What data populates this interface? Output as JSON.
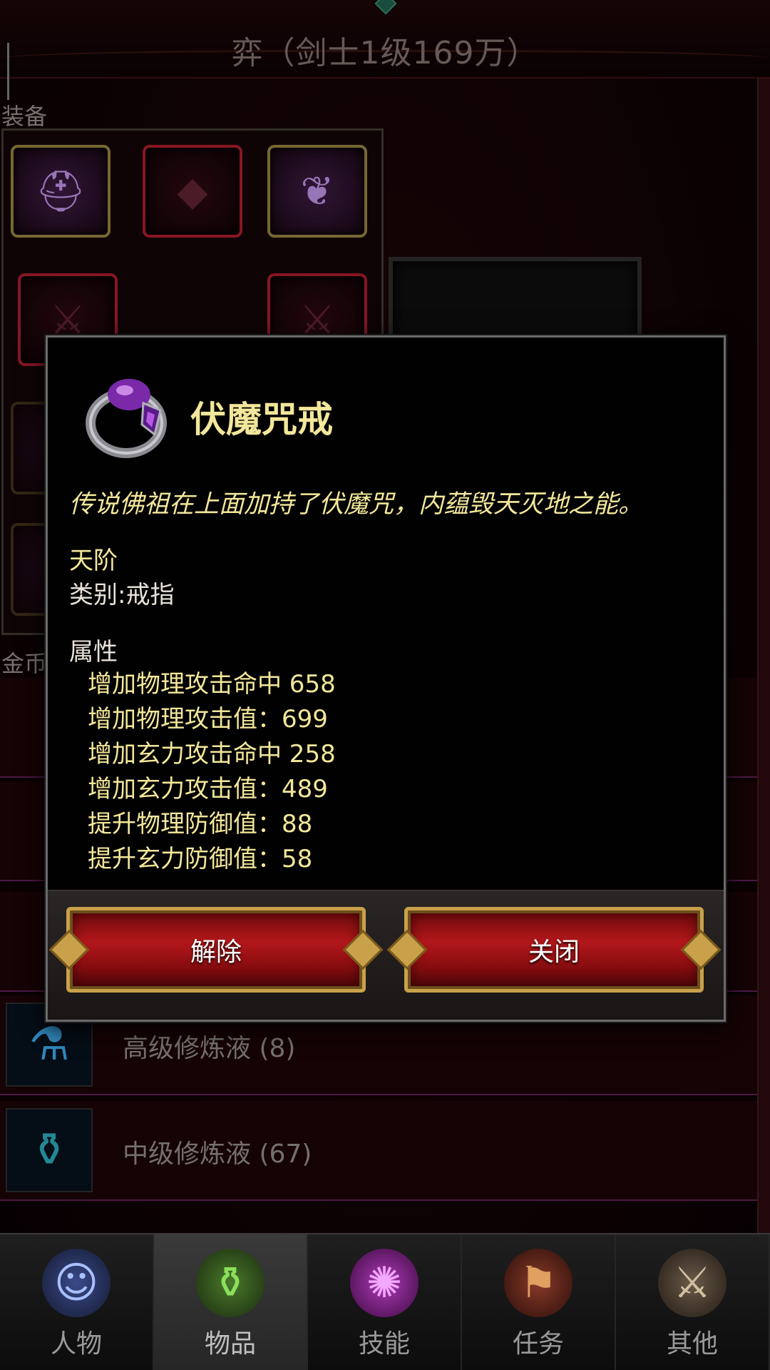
{
  "header": {
    "title": "弈（剑士1级169万）"
  },
  "equipment": {
    "section_label": "装备"
  },
  "inventory": {
    "gold_label": "金币:",
    "items": [
      {
        "label": "高级修炼液 (8)",
        "icon": "flask-icon"
      },
      {
        "label": "中级修炼液 (67)",
        "icon": "potion-icon"
      }
    ]
  },
  "popup": {
    "item_name": "伏魔咒戒",
    "description": "传说佛祖在上面加持了伏魔咒，内蕴毁天灭地之能。",
    "grade": "天阶",
    "category": "类别:戒指",
    "attributes_heading": "属性",
    "attributes": [
      "增加物理攻击命中 658",
      "增加物理攻击值：699",
      "增加玄力攻击命中 258",
      "增加玄力攻击值：489",
      "提升物理防御值：88",
      "提升玄力防御值：58"
    ],
    "buttons": {
      "unequip": "解除",
      "close": "关闭"
    }
  },
  "nav": {
    "tabs": [
      {
        "label": "人物",
        "icon": "hero-icon",
        "active": false
      },
      {
        "label": "物品",
        "icon": "bag-icon",
        "active": true
      },
      {
        "label": "技能",
        "icon": "skill-icon",
        "active": false
      },
      {
        "label": "任务",
        "icon": "quest-icon",
        "active": false
      },
      {
        "label": "其他",
        "icon": "other-icon",
        "active": false
      }
    ]
  }
}
